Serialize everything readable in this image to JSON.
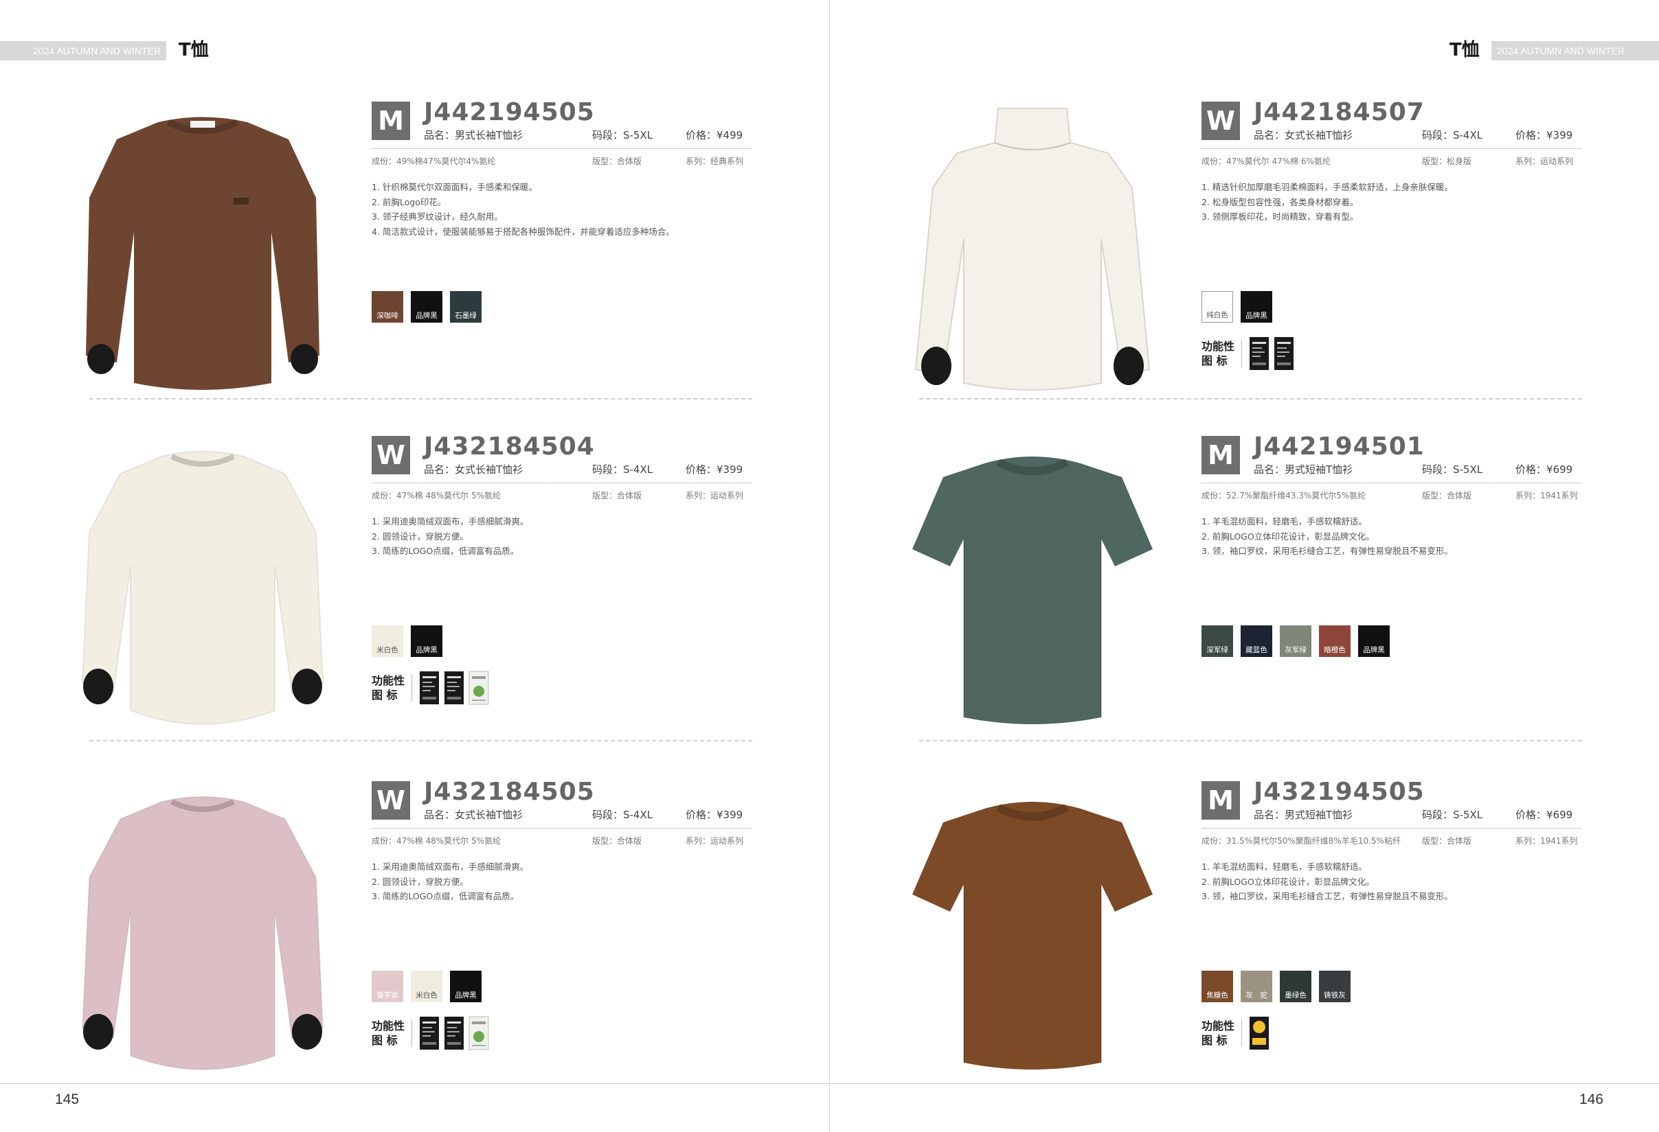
{
  "header": {
    "season": "2024 AUTUMN AND WINTER",
    "category": "T恤"
  },
  "left_page": {
    "page_number": "145",
    "products": [
      {
        "gender": "M",
        "code": "J442194505",
        "name": "品名：男式长袖T恤衫",
        "size": "码段：S-5XL",
        "price": "价格：¥499",
        "composition": "成份：49%棉47%莫代尔4%氨纶",
        "fit": "版型：合体版",
        "series": "系列：经典系列",
        "features": [
          "1. 针织棉莫代尔双面面料，手感柔和保暖。",
          "2. 前胸Logo印花。",
          "3. 领子经典罗纹设计，经久耐用。",
          "4. 简洁款式设计，使服装能够易于搭配各种服饰配件，并能穿着适应多种场合。"
        ],
        "garment": {
          "style": "long-sleeve",
          "color": "#6e4530"
        },
        "colors": [
          {
            "label": "深咖啡",
            "hex": "#6e4530"
          },
          {
            "label": "品牌黑",
            "hex": "#111111"
          },
          {
            "label": "石墨绿",
            "hex": "#2c3b3d"
          }
        ],
        "function_label": "",
        "function_tags": []
      },
      {
        "gender": "W",
        "code": "J432184504",
        "name": "品名：女式长袖T恤衫",
        "size": "码段：S-4XL",
        "price": "价格：¥399",
        "composition": "成份：47%棉 48%莫代尔 5%氨纶",
        "fit": "版型：合体版",
        "series": "系列：运动系列",
        "features": [
          "1. 采用迪奥简绒双面布，手感细腻滑爽。",
          "2. 圆领设计，穿脱方便。",
          "3. 简练的LOGO点缀，低调富有品质。"
        ],
        "garment": {
          "style": "long-sleeve-w",
          "color": "#f2efe2"
        },
        "colors": [
          {
            "label": "米白色",
            "hex": "#eeede0",
            "light": true
          },
          {
            "label": "品牌黑",
            "hex": "#111111"
          }
        ],
        "function_label": "功能性图 标",
        "function_tags": [
          "dark-tag",
          "dark-tag",
          "green-tag"
        ]
      },
      {
        "gender": "W",
        "code": "J432184505",
        "name": "品名：女式长袖T恤衫",
        "size": "码段：S-4XL",
        "price": "价格：¥399",
        "composition": "成份：47%棉 48%莫代尔 5%氨纶",
        "fit": "版型：合体版",
        "series": "系列：运动系列",
        "features": [
          "1. 采用迪奥简绒双面布，手感细腻滑爽。",
          "2. 圆领设计，穿脱方便。",
          "3. 简练的LOGO点缀，低调富有品质。"
        ],
        "garment": {
          "style": "long-sleeve-w",
          "color": "#dcbfc4"
        },
        "colors": [
          {
            "label": "香芋紫",
            "hex": "#e2c9cc"
          },
          {
            "label": "米白色",
            "hex": "#eeede0",
            "light": true
          },
          {
            "label": "品牌黑",
            "hex": "#111111"
          }
        ],
        "function_label": "功能性图 标",
        "function_tags": [
          "dark-tag",
          "dark-tag",
          "green-tag"
        ]
      }
    ]
  },
  "right_page": {
    "page_number": "146",
    "products": [
      {
        "gender": "W",
        "code": "J442184507",
        "name": "品名：女式长袖T恤衫",
        "size": "码段：S-4XL",
        "price": "价格：¥399",
        "composition": "成份：47%莫代尔 47%棉 6%氨纶",
        "fit": "版型：松身版",
        "series": "系列：运动系列",
        "features": [
          "1. 精选针织加厚磨毛羽柔棉面料，手感柔软舒适，上身亲肤保暖。",
          "2. 松身版型包容性强，各类身材都穿着。",
          "3. 领侧厚板印花，时尚精致，穿着有型。"
        ],
        "garment": {
          "style": "mock-neck",
          "color": "#f3f1ea"
        },
        "colors": [
          {
            "label": "纯白色",
            "hex": "#ffffff",
            "light": true,
            "bordered": true
          },
          {
            "label": "品牌黑",
            "hex": "#111111"
          }
        ],
        "function_label": "功能性图 标",
        "function_tags": [
          "dark-tag",
          "dark-tag"
        ]
      },
      {
        "gender": "M",
        "code": "J442194501",
        "name": "品名：男式短袖T恤衫",
        "size": "码段：S-5XL",
        "price": "价格：¥699",
        "composition": "成份：52.7%聚酯纤维43.3%莫代尔5%氨纶",
        "fit": "版型：合体版",
        "series": "系列：1941系列",
        "features": [
          "1. 羊毛混纺面料，轻磨毛，手感软糯舒适。",
          "2. 前胸LOGO立体印花设计，彰显品牌文化。",
          "3. 领，袖口罗纹，采用毛衫缝合工艺，有弹性易穿脱且不易变形。"
        ],
        "garment": {
          "style": "short-sleeve",
          "color": "#4f6760"
        },
        "colors": [
          {
            "label": "深军绿",
            "hex": "#3c4a46"
          },
          {
            "label": "藏蓝色",
            "hex": "#1d2333"
          },
          {
            "label": "灰军绿",
            "hex": "#7f8779"
          },
          {
            "label": "暗橙色",
            "hex": "#8e463a"
          },
          {
            "label": "品牌黑",
            "hex": "#111111"
          }
        ],
        "function_label": "",
        "function_tags": []
      },
      {
        "gender": "M",
        "code": "J432194505",
        "name": "品名：男式短袖T恤衫",
        "size": "码段：S-5XL",
        "price": "价格：¥699",
        "composition": "成份：31.5%莫代尔50%聚酯纤维8%羊毛10.5%粘纤",
        "fit": "版型：合体版",
        "series": "系列：1941系列",
        "features": [
          "1. 羊毛混纺面料，轻磨毛，手感软糯舒适。",
          "2. 前胸LOGO立体印花设计，彰显品牌文化。",
          "3. 领，袖口罗纹，采用毛衫缝合工艺，有弹性易穿脱且不易变形。"
        ],
        "garment": {
          "style": "short-sleeve",
          "color": "#7c4a26"
        },
        "colors": [
          {
            "label": "焦糖色",
            "hex": "#7a4a2a"
          },
          {
            "label": "灰　驼",
            "hex": "#9c9282"
          },
          {
            "label": "墨绿色",
            "hex": "#2f3835"
          },
          {
            "label": "铸铁灰",
            "hex": "#3a3d3f"
          }
        ],
        "function_label": "功能性图 标",
        "function_tags": [
          "yellow-tag"
        ]
      }
    ]
  }
}
